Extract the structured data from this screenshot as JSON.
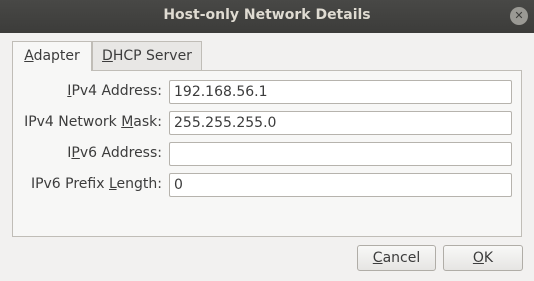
{
  "window": {
    "title": "Host-only Network Details",
    "close_glyph": "✕"
  },
  "tabs": [
    {
      "label_mnemonic": "A",
      "label_rest": "dapter",
      "selected": true
    },
    {
      "label_mnemonic": "D",
      "label_rest": "HCP Server",
      "selected": false
    }
  ],
  "fields": {
    "ipv4_address": {
      "label_pre": "",
      "label_mnemonic": "I",
      "label_post": "Pv4 Address:",
      "value": "192.168.56.1"
    },
    "ipv4_mask": {
      "label_pre": "IPv4 Network ",
      "label_mnemonic": "M",
      "label_post": "ask:",
      "value": "255.255.255.0"
    },
    "ipv6_address": {
      "label_pre": "I",
      "label_mnemonic": "P",
      "label_post": "v6 Address:",
      "value": ""
    },
    "ipv6_prefix": {
      "label_pre": "IPv6 Prefix ",
      "label_mnemonic": "L",
      "label_post": "ength:",
      "value": "0"
    }
  },
  "buttons": {
    "cancel": {
      "mnemonic": "C",
      "rest": "ancel"
    },
    "ok": {
      "mnemonic": "O",
      "rest": "K"
    }
  },
  "colors": {
    "titlebar": "#3c3c3a",
    "title_text": "#dfdbd2",
    "dialog_bg": "#f2f1f0",
    "panel_bg": "#f7f7f6"
  }
}
